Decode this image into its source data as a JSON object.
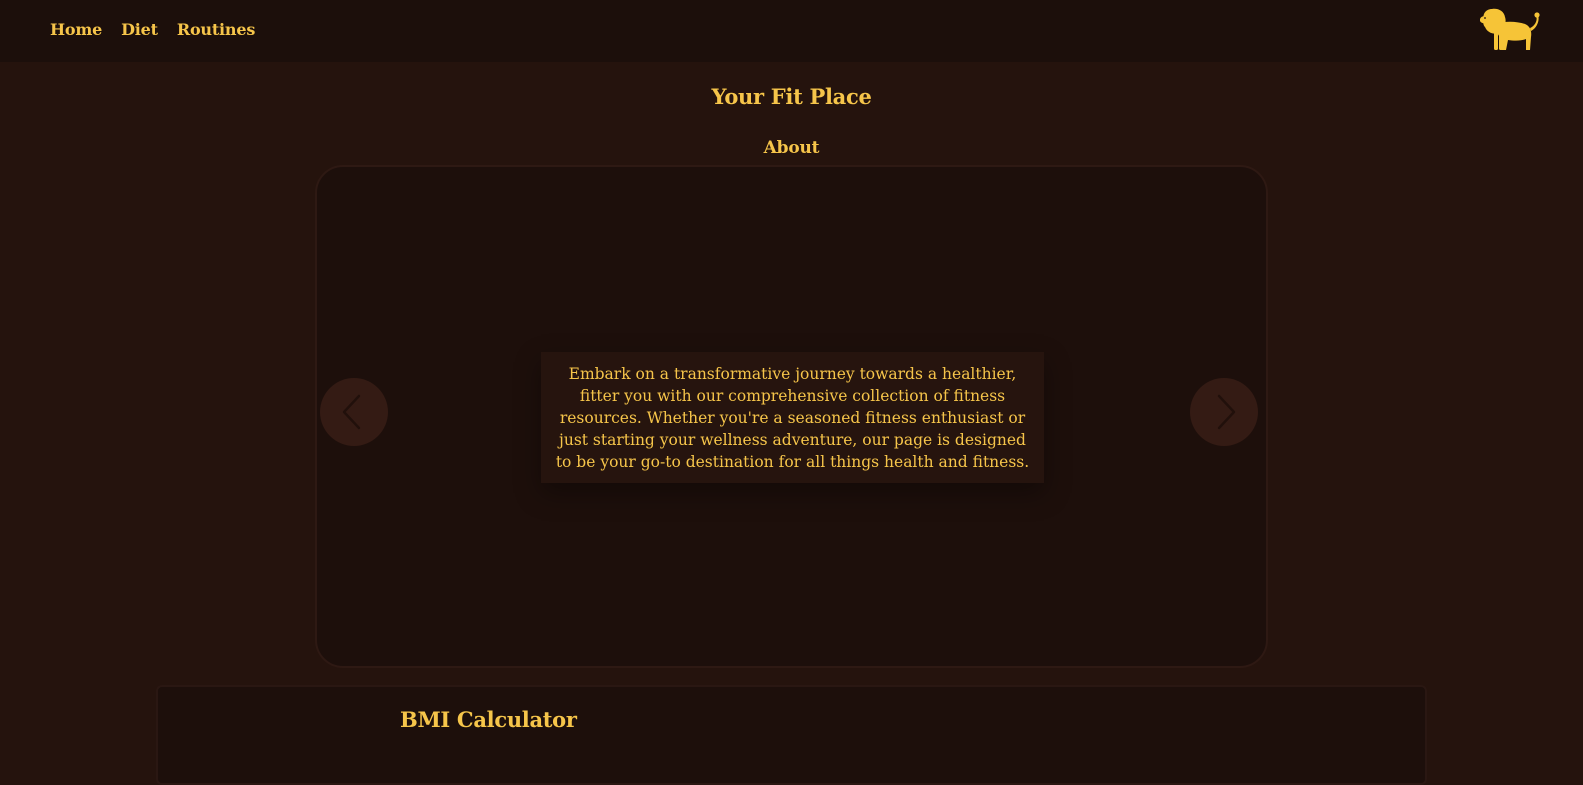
{
  "nav": {
    "items": [
      {
        "label": "Home"
      },
      {
        "label": "Diet"
      },
      {
        "label": "Routines"
      }
    ]
  },
  "logo": {
    "icon": "lion-icon",
    "color": "#f6c437"
  },
  "header": {
    "title": "Your Fit Place"
  },
  "about": {
    "title": "About",
    "carousel": {
      "text": "Embark on a transformative journey towards a healthier, fitter you with our comprehensive collection of fitness resources. Whether you're a seasoned fitness enthusiast or just starting your wellness adventure, our page is designed to be your go-to destination for all things health and fitness.",
      "prev_icon": "chevron-left-icon",
      "next_icon": "chevron-right-icon"
    }
  },
  "bmi": {
    "title": "BMI Calculator"
  },
  "colors": {
    "background": "#25130d",
    "topbar": "#1c0f0b",
    "accent": "#f6c54a",
    "card": "#1d0f0b"
  }
}
